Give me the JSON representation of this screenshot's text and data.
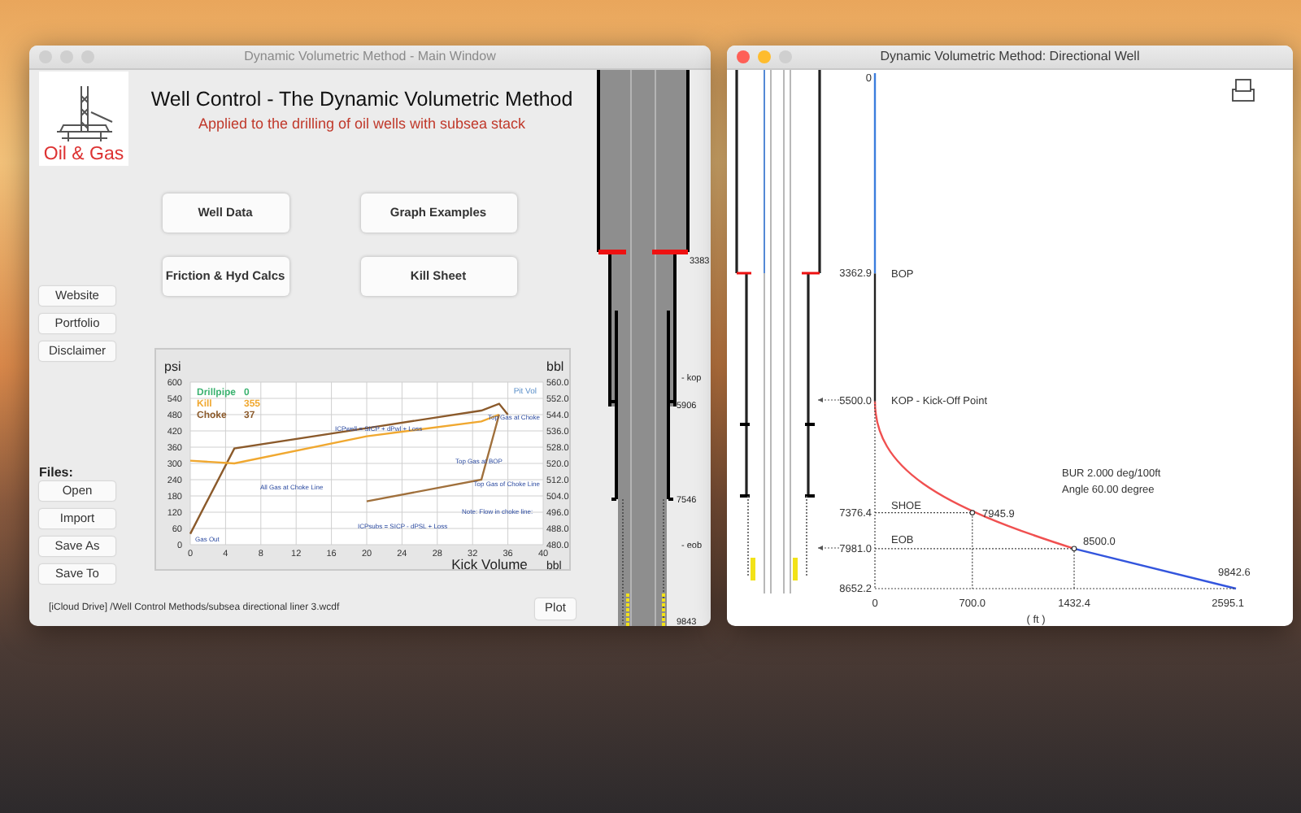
{
  "main_window": {
    "title": "Dynamic Volumetric Method - Main Window",
    "active": false,
    "logo_text": "Oil & Gas",
    "heading": "Well Control - The Dynamic Volumetric Method",
    "subtitle": "Applied to the drilling of oil wells with subsea stack",
    "menu_buttons": [
      "Well Data",
      "Graph Examples",
      "Friction & Hyd Calcs",
      "Kill Sheet"
    ],
    "side_links": [
      "Website",
      "Portfolio",
      "Disclaimer"
    ],
    "files_label": "Files:",
    "file_buttons": [
      "Open",
      "Import",
      "Save As",
      "Save To"
    ],
    "file_path": "[iCloud Drive] /Well Control Methods/subsea directional liner 3.wcdf",
    "plot_button": "Plot",
    "chart": {
      "legend": [
        {
          "label": "Drillpipe",
          "value": "0",
          "color": "#3cb371"
        },
        {
          "label": "Kill",
          "value": "355",
          "color": "#f0a830"
        },
        {
          "label": "Choke",
          "value": "37",
          "color": "#8b5a2b"
        }
      ],
      "pit_volume_label": "Pit Vol",
      "right_axis": {
        "unit": "bbl",
        "ticks": [
          "560.0",
          "552.0",
          "544.0",
          "536.0",
          "528.0",
          "520.0",
          "512.0",
          "504.0",
          "496.0",
          "488.0",
          "480.0"
        ]
      },
      "x_unit": "bbl",
      "chart_data": {
        "type": "line",
        "xlabel": "Kick Volume",
        "ylabel": "psi",
        "x": [
          0,
          5,
          20,
          33,
          35,
          36
        ],
        "series": [
          {
            "color": "#8b5a2b",
            "values": [
              40,
              355,
              430,
              495,
              520,
              480
            ]
          },
          {
            "color": "#f0a830",
            "values": [
              310,
              300,
              400,
              455,
              480,
              null
            ]
          },
          {
            "color": "#a0703c",
            "values": [
              null,
              null,
              160,
              240,
              480,
              null
            ]
          }
        ],
        "xlim": [
          0,
          40
        ],
        "ylim": [
          0,
          600
        ],
        "xticks": [
          0,
          4,
          8,
          12,
          16,
          20,
          24,
          28,
          32,
          36,
          40
        ],
        "yticks": [
          0,
          60,
          120,
          180,
          240,
          300,
          360,
          420,
          480,
          540,
          600
        ],
        "grid": true,
        "annotations": [
          "Gas Out",
          "All Gas at Choke Line",
          "ICPwell = SICP + dPwl + Loss",
          "ICPsubs = SICP - dPSL + Loss",
          "Top Gas at BOP",
          "Top Gas at Choke",
          "Top Gas of Choke Line",
          "Note: Flow in choke line:"
        ]
      }
    },
    "well_schematic": {
      "depth_labels": [
        "3383",
        "5906",
        "7546",
        "9843"
      ],
      "markers": [
        "- kop",
        "- eob"
      ]
    }
  },
  "directional_window": {
    "title": "Dynamic Volumetric Method: Directional Well",
    "active": true,
    "trajectory": {
      "depth_labels": [
        "0",
        "3362.9",
        "5500.0",
        "7376.4",
        "7981.0",
        "8652.2"
      ],
      "point_labels": [
        "BOP",
        "KOP - Kick-Off Point",
        "SHOE",
        "7945.9",
        "EOB",
        "8500.0",
        "9842.6"
      ],
      "x_labels": [
        "0",
        "700.0",
        "1432.4",
        "2595.1"
      ],
      "x_unit": "( ft )",
      "notes": [
        "BUR 2.000 deg/100ft",
        "Angle 60.00 degree"
      ]
    }
  }
}
